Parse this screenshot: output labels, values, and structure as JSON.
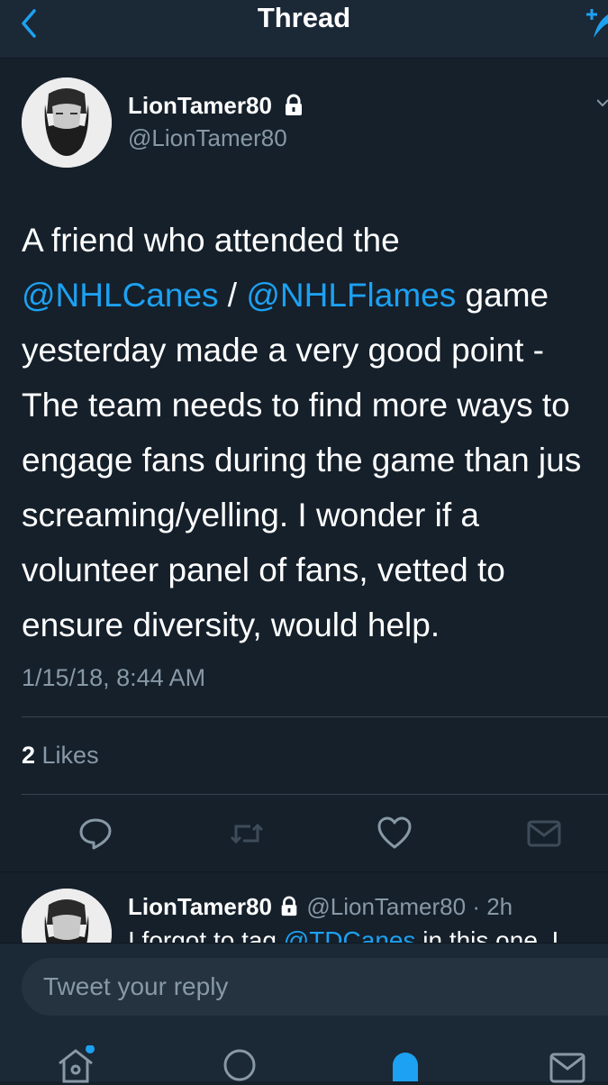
{
  "header": {
    "title": "Thread",
    "back_icon": "chevron-left-icon",
    "compose_icon": "compose-icon"
  },
  "tweet": {
    "display_name": "LionTamer80",
    "handle": "@LionTamer80",
    "text": {
      "line1": "A friend who attended the",
      "mention1": "@NHLCanes",
      "sep": " / ",
      "mention2": "@NHLFlames",
      "line2_tail": " game",
      "line3": "yesterday made a very good point -",
      "line4": "The team needs to find more ways to",
      "line5": "engage fans during the game than jus",
      "line6": "screaming/yelling. I wonder if a",
      "line7": "volunteer panel of fans, vetted to",
      "line8": "ensure diversity, would help."
    },
    "timestamp": "1/15/18, 8:44 AM",
    "likes_count": "2",
    "likes_label": " Likes"
  },
  "reply": {
    "display_name": "LionTamer80",
    "handle": "@LionTamer80",
    "time": " · 2h",
    "text_start": "I forgot to tag ",
    "mention": "@TDCanes",
    "text_end": " in this one. I"
  },
  "compose": {
    "placeholder": "Tweet your reply"
  },
  "colors": {
    "background": "#15202b",
    "bar": "#1b2836",
    "accent": "#1da1f2",
    "muted": "#8899a6"
  }
}
